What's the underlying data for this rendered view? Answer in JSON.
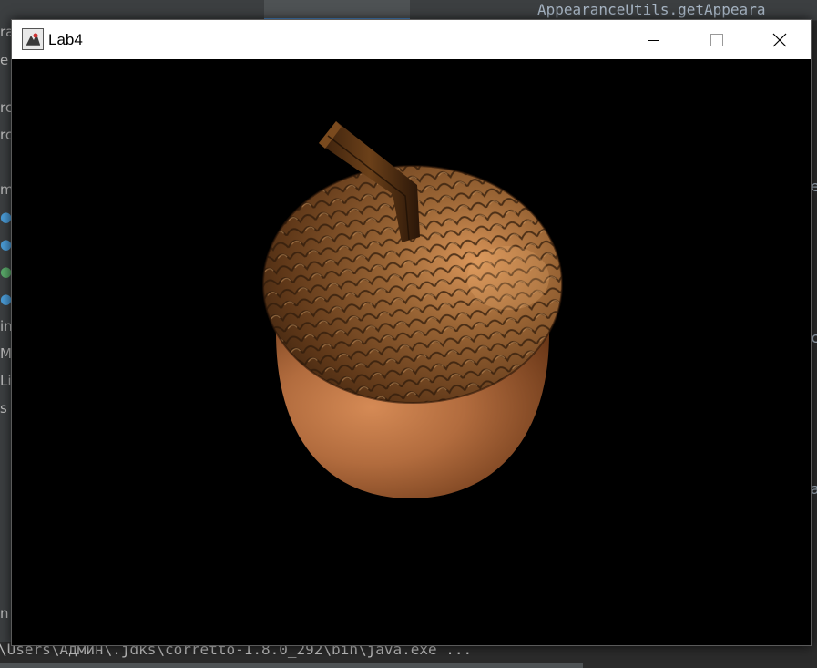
{
  "window": {
    "title": "Lab4",
    "icon": "java-app-icon",
    "controls": [
      "minimize-icon",
      "maximize-icon",
      "close-icon"
    ]
  },
  "scene": {
    "subject": "acorn-3d-model",
    "background_color": "#000000",
    "cap_color": "#8a5a32",
    "body_color": "#b87344",
    "stem_color": "#5a3416"
  },
  "ide": {
    "code_fragment": "AppearanceUtils.getAppeara",
    "console_line": "\\Users\\Админ\\.jdks\\corretto-1.8.0_292\\bin\\java.exe ...",
    "left_fragments": [
      "ra",
      "e",
      "rc",
      "rc",
      "m",
      "",
      "",
      "",
      "",
      "in",
      "M",
      "Lib",
      "s a",
      "",
      "n"
    ],
    "right_fragments": [
      "e",
      "c",
      "a"
    ]
  }
}
